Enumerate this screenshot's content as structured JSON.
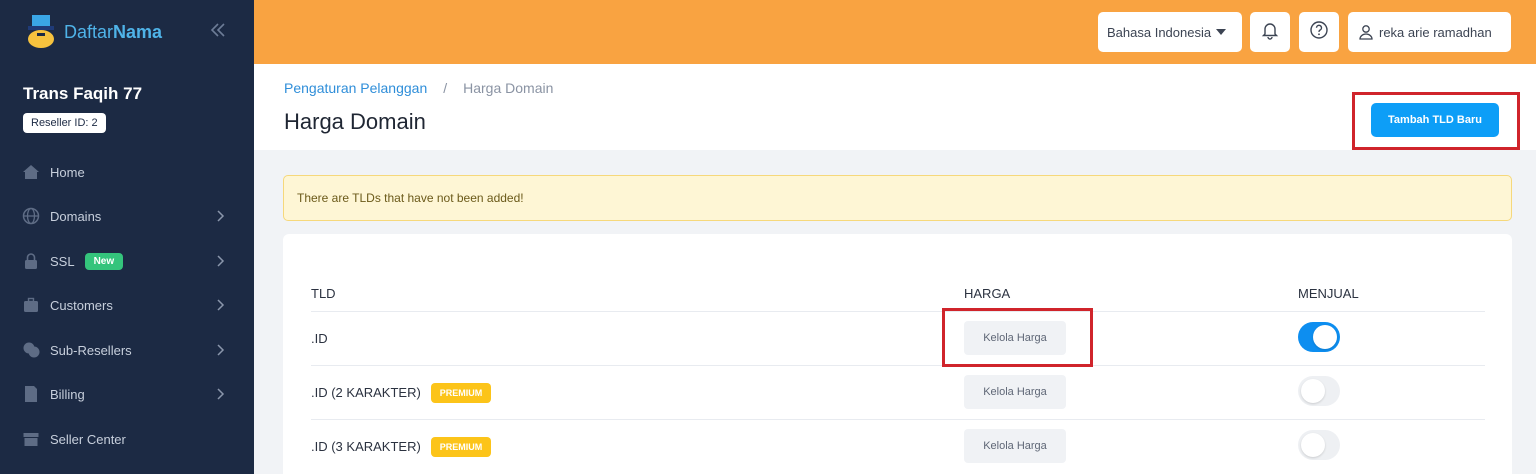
{
  "brand": {
    "logo_word_1": "Daftar",
    "logo_word_2": "Nama",
    "accent": "#f9a341",
    "sidebar_bg": "#1c2a44"
  },
  "sidebar": {
    "org_name": "Trans Faqih 77",
    "reseller_id": "Reseller ID: 2",
    "items": [
      {
        "label": "Home",
        "icon": "home-icon",
        "has_chevron": false
      },
      {
        "label": "Domains",
        "icon": "globe-icon",
        "has_chevron": true
      },
      {
        "label": "SSL",
        "icon": "lock-icon",
        "has_chevron": true,
        "badge": "New"
      },
      {
        "label": "Customers",
        "icon": "briefcase-icon",
        "has_chevron": true
      },
      {
        "label": "Sub-Resellers",
        "icon": "users-icon",
        "has_chevron": true
      },
      {
        "label": "Billing",
        "icon": "document-icon",
        "has_chevron": true
      },
      {
        "label": "Seller Center",
        "icon": "store-icon",
        "has_chevron": false
      }
    ]
  },
  "topbar": {
    "language": "Bahasa Indonesia",
    "user_name": "reka arie ramadhan"
  },
  "header": {
    "breadcrumb": [
      "Pengaturan Pelanggan",
      "Harga Domain"
    ],
    "breadcrumb_sep": "/",
    "title": "Harga Domain",
    "add_button": "Tambah TLD Baru"
  },
  "alert": {
    "text": "There are TLDs that have not been added!"
  },
  "table": {
    "columns": [
      "TLD",
      "HARGA",
      "MENJUAL"
    ],
    "rows": [
      {
        "tld": ".ID",
        "badge": null,
        "action": "Kelola Harga",
        "selling": true
      },
      {
        "tld": ".ID (2 KARAKTER)",
        "badge": "PREMIUM",
        "action": "Kelola Harga",
        "selling": false
      },
      {
        "tld": ".ID (3 KARAKTER)",
        "badge": "PREMIUM",
        "action": "Kelola Harga",
        "selling": false
      }
    ]
  }
}
